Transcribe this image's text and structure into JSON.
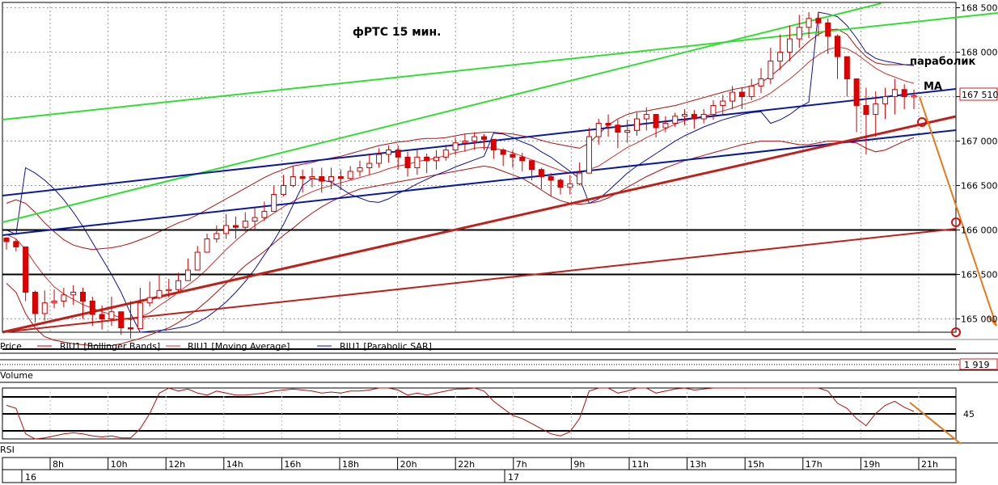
{
  "chart_data": [
    {
      "type": "candlestick",
      "title": "фРТС   15 мин.",
      "ylim": [
        164850,
        168560
      ],
      "yticks": [
        {
          "value": 168500,
          "label": "168 500"
        },
        {
          "value": 168000,
          "label": "168 000"
        },
        {
          "value": 167500,
          "label": "167 500"
        },
        {
          "value": 167000,
          "label": "167 000"
        },
        {
          "value": 166500,
          "label": "166 500"
        },
        {
          "value": 166000,
          "label": "166 000"
        },
        {
          "value": 165500,
          "label": "165 500"
        },
        {
          "value": 165000,
          "label": "165 000"
        }
      ],
      "last_price": {
        "value": 167510,
        "label": "167 510"
      },
      "series_legend": [
        "Price",
        "RIU1 [Bollinger Bands]",
        "RIU1 [Moving Average]",
        "RIU1 [Parabolic SAR]"
      ],
      "annotations": [
        {
          "text": "параболик",
          "x": 1133,
          "y": 167860
        },
        {
          "text": "MA",
          "x": 1137,
          "y": 167600
        }
      ],
      "horizontal_levels": [
        166000,
        165500,
        164660
      ],
      "close": [
        165870,
        165810,
        165300,
        165060,
        165180,
        165200,
        165270,
        165300,
        165200,
        165050,
        165000,
        165080,
        164900,
        164890,
        165180,
        165240,
        165320,
        165330,
        165430,
        165550,
        165750,
        165900,
        165960,
        166050,
        166030,
        166100,
        166140,
        166210,
        166400,
        166500,
        166600,
        166580,
        166600,
        166550,
        166600,
        166580,
        166660,
        166700,
        166750,
        166850,
        166900,
        166820,
        166700,
        166820,
        166780,
        166820,
        166900,
        166980,
        167000,
        167050,
        167020,
        166900,
        166850,
        166820,
        166780,
        166680,
        166600,
        166560,
        166480,
        166520,
        166640,
        167050,
        167200,
        167180,
        167100,
        167120,
        167250,
        167300,
        167150,
        167200,
        167280,
        167300,
        167250,
        167300,
        167400,
        167450,
        167550,
        167500,
        167620,
        167700,
        167900,
        168000,
        168150,
        168280,
        168380,
        168330,
        168180,
        167950,
        167700,
        167400,
        167300,
        167420,
        167500,
        167580,
        167500,
        167510
      ],
      "high": [
        165920,
        165900,
        165520,
        165320,
        165320,
        165330,
        165350,
        165380,
        165350,
        165250,
        165150,
        165250,
        165050,
        165200,
        165350,
        165420,
        165500,
        165450,
        165520,
        165680,
        165820,
        165960,
        166050,
        166180,
        166150,
        166200,
        166250,
        166320,
        166500,
        166620,
        166720,
        166680,
        166700,
        166700,
        166700,
        166680,
        166720,
        166780,
        166860,
        166920,
        166950,
        166950,
        166880,
        166900,
        166860,
        166900,
        166960,
        167040,
        167080,
        167100,
        167080,
        167000,
        166920,
        166900,
        166870,
        166780,
        166700,
        166640,
        166580,
        166620,
        166760,
        167150,
        167250,
        167300,
        167240,
        167240,
        167320,
        167380,
        167300,
        167280,
        167320,
        167360,
        167350,
        167360,
        167460,
        167520,
        167620,
        167600,
        167700,
        167820,
        168050,
        168200,
        168300,
        168420,
        168450,
        168450,
        168380,
        168200,
        167920,
        167700,
        167600,
        167560,
        167600,
        167700,
        167640,
        167580
      ],
      "low": [
        165780,
        165760,
        165200,
        164960,
        164980,
        165120,
        165130,
        165160,
        165000,
        164920,
        164880,
        164920,
        164820,
        164780,
        165060,
        165140,
        165220,
        165240,
        165300,
        165440,
        165600,
        165760,
        165860,
        165900,
        165900,
        165980,
        166000,
        166100,
        166260,
        166380,
        166480,
        166420,
        166480,
        166420,
        166460,
        166450,
        166560,
        166600,
        166620,
        166700,
        166760,
        166680,
        166600,
        166620,
        166640,
        166680,
        166780,
        166840,
        166880,
        166900,
        166900,
        166800,
        166720,
        166700,
        166660,
        166560,
        166460,
        166380,
        166400,
        166400,
        166500,
        166700,
        166960,
        167050,
        166920,
        166980,
        167060,
        167120,
        167040,
        167100,
        167160,
        167180,
        167140,
        167200,
        167240,
        167300,
        167360,
        167360,
        167460,
        167540,
        167640,
        167800,
        167900,
        168050,
        168160,
        168180,
        167980,
        167700,
        167500,
        167100,
        166850,
        167050,
        167250,
        167300,
        167360,
        167360
      ],
      "bb_upper": [
        166300,
        166340,
        166300,
        166200,
        166080,
        165980,
        165890,
        165830,
        165800,
        165780,
        165790,
        165800,
        165820,
        165850,
        165890,
        165930,
        165980,
        166030,
        166080,
        166120,
        166170,
        166230,
        166290,
        166350,
        166410,
        166470,
        166530,
        166590,
        166640,
        166680,
        166720,
        166740,
        166760,
        166790,
        166810,
        166830,
        166860,
        166890,
        166920,
        166950,
        166970,
        166990,
        167000,
        167020,
        167030,
        167030,
        167040,
        167060,
        167080,
        167090,
        167100,
        167100,
        167090,
        167080,
        167060,
        167040,
        167010,
        166980,
        166960,
        166940,
        166920,
        166980,
        167080,
        167180,
        167250,
        167300,
        167330,
        167340,
        167360,
        167380,
        167400,
        167430,
        167460,
        167490,
        167520,
        167550,
        167580,
        167600,
        167620,
        167660,
        167730,
        167820,
        167920,
        168020,
        168120,
        168200,
        168250,
        168260,
        168200,
        168060,
        167950,
        167880,
        167860,
        167860,
        167860,
        167860
      ],
      "bb_lower": [
        165400,
        165300,
        165060,
        164900,
        164800,
        164760,
        164740,
        164720,
        164710,
        164700,
        164700,
        164700,
        164720,
        164750,
        164780,
        164820,
        164860,
        164900,
        164960,
        165030,
        165110,
        165200,
        165300,
        165400,
        165500,
        165600,
        165680,
        165760,
        165850,
        165940,
        166020,
        166110,
        166190,
        166260,
        166320,
        166370,
        166420,
        166460,
        166480,
        166500,
        166520,
        166540,
        166560,
        166580,
        166600,
        166620,
        166640,
        166660,
        166680,
        166700,
        166720,
        166700,
        166660,
        166620,
        166580,
        166520,
        166450,
        166380,
        166330,
        166300,
        166290,
        166300,
        166320,
        166360,
        166420,
        166480,
        166540,
        166600,
        166650,
        166700,
        166740,
        166780,
        166810,
        166840,
        166870,
        166900,
        166930,
        166960,
        166980,
        167000,
        167000,
        167000,
        166980,
        166960,
        166960,
        166980,
        167000,
        167000,
        166990,
        166980,
        166920,
        166880,
        166900,
        166950,
        167000,
        167040
      ],
      "ma": [
        165950,
        165900,
        165780,
        165620,
        165480,
        165360,
        165280,
        165220,
        165160,
        165120,
        165080,
        165050,
        165010,
        164990,
        165020,
        165070,
        165150,
        165220,
        165300,
        165380,
        165460,
        165560,
        165670,
        165780,
        165880,
        165970,
        166050,
        166120,
        166190,
        166260,
        166320,
        166380,
        166430,
        166470,
        166500,
        166530,
        166560,
        166590,
        166620,
        166650,
        166690,
        166720,
        166740,
        166770,
        166790,
        166810,
        166840,
        166870,
        166890,
        166920,
        166930,
        166920,
        166900,
        166870,
        166830,
        166790,
        166750,
        166710,
        166670,
        166640,
        166640,
        166680,
        166720,
        166790,
        166860,
        166930,
        166980,
        167040,
        167090,
        167140,
        167190,
        167230,
        167260,
        167280,
        167310,
        167340,
        167370,
        167410,
        167440,
        167480,
        167540,
        167620,
        167700,
        167790,
        167890,
        167970,
        168030,
        168060,
        168040,
        167980,
        167900,
        167820,
        167760,
        167720,
        167680,
        167650
      ],
      "sar": [
        166000,
        165950,
        166700,
        166640,
        166560,
        166460,
        166340,
        166200,
        166040,
        165860,
        165680,
        165500,
        165300,
        165060,
        164850,
        164860,
        164870,
        164880,
        164900,
        164920,
        164960,
        165020,
        165100,
        165190,
        165300,
        165420,
        165560,
        165720,
        165880,
        166060,
        166280,
        166500,
        166580,
        166560,
        166540,
        166470,
        166400,
        166360,
        166320,
        166310,
        166350,
        166410,
        166460,
        166520,
        166570,
        166620,
        166660,
        166710,
        166750,
        166790,
        166830,
        167090,
        167080,
        167040,
        166990,
        166950,
        166880,
        166820,
        166740,
        166660,
        166580,
        166300,
        166350,
        166440,
        166540,
        166640,
        166720,
        166790,
        166860,
        166930,
        167000,
        167060,
        167110,
        167160,
        167200,
        167240,
        167270,
        167300,
        167320,
        167330,
        167200,
        167240,
        167300,
        167380,
        167440,
        168450,
        168430,
        168400,
        168300,
        168160,
        168000,
        167930,
        167900,
        167880,
        167860,
        167850
      ],
      "sar_label": "параболик"
    },
    {
      "type": "bar",
      "series_legend": [
        "Volume"
      ],
      "last_value": {
        "value": 1919,
        "label": "1 919"
      }
    },
    {
      "type": "line",
      "series_legend": [
        "RSI"
      ],
      "yticks": [
        {
          "value": 45,
          "label": "45"
        }
      ],
      "rsi": [
        58,
        55,
        30,
        25,
        26,
        28,
        30,
        31,
        30,
        28,
        27,
        28,
        26,
        26,
        35,
        50,
        70,
        75,
        72,
        74,
        70,
        68,
        72,
        70,
        68,
        68,
        69,
        70,
        72,
        73,
        74,
        73,
        72,
        70,
        71,
        70,
        72,
        72,
        73,
        75,
        75,
        73,
        68,
        70,
        68,
        70,
        72,
        74,
        74,
        75,
        72,
        62,
        55,
        48,
        45,
        40,
        35,
        30,
        28,
        32,
        45,
        72,
        80,
        76,
        70,
        72,
        75,
        77,
        70,
        72,
        74,
        75,
        73,
        74,
        76,
        78,
        80,
        78,
        80,
        82,
        85,
        86,
        88,
        90,
        90,
        85,
        72,
        60,
        55,
        45,
        38,
        50,
        58,
        62,
        56,
        52
      ]
    }
  ],
  "time_axis": {
    "days": [
      "16",
      "17"
    ],
    "hours": [
      "8h",
      "10h",
      "12h",
      "14h",
      "16h",
      "18h",
      "20h",
      "22h",
      "7h",
      "9h",
      "11h",
      "13h",
      "15h",
      "17h",
      "19h",
      "21h"
    ]
  },
  "colors": {
    "bull": "#ffffff",
    "bear": "#e00000",
    "candle_outline": "#cc0000",
    "bb": "#b01010",
    "ma": "#d03030",
    "sar": "#1010a0",
    "trend_green": "#33dd33",
    "trend_blue": "#0a1aa0",
    "trend_red": "#c0201a",
    "forecast": "#e87818"
  }
}
